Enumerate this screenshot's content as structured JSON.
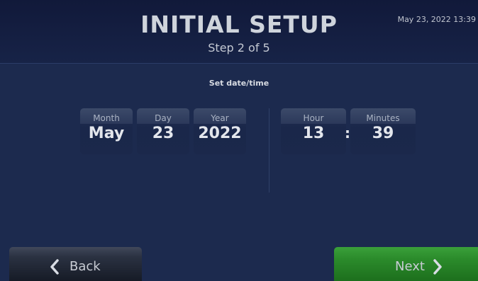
{
  "header": {
    "title": "INITIAL SETUP",
    "subtitle": "Step 2 of 5",
    "datetime": "May 23, 2022 13:39"
  },
  "section": {
    "label": "Set date/time"
  },
  "date": {
    "month": {
      "label": "Month",
      "value": "May"
    },
    "day": {
      "label": "Day",
      "value": "23"
    },
    "year": {
      "label": "Year",
      "value": "2022"
    }
  },
  "time": {
    "hour": {
      "label": "Hour",
      "value": "13"
    },
    "separator": ":",
    "minutes": {
      "label": "Minutes",
      "value": "39"
    }
  },
  "footer": {
    "back": {
      "label": "Back",
      "icon": "chevron-left-icon"
    },
    "next": {
      "label": "Next",
      "icon": "chevron-right-icon"
    }
  },
  "colors": {
    "background": "#1c2a4e",
    "header": "#11193a",
    "next_button": "#2b8b2b",
    "back_button": "#2a3141",
    "text": "#e3e6ec"
  }
}
